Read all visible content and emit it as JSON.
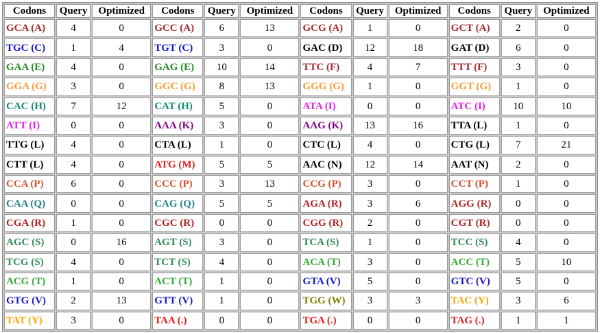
{
  "headers": [
    "Codons",
    "Query",
    "Optimized",
    "Codons",
    "Query",
    "Optimized",
    "Codons",
    "Query",
    "Optimized",
    "Codons",
    "Query",
    "Optimized"
  ],
  "rows": [
    [
      {
        "codon": "GCA (A)",
        "color": "#a52a2a",
        "query": "4",
        "optimized": "0"
      },
      {
        "codon": "GCC (A)",
        "color": "#a52a2a",
        "query": "6",
        "optimized": "13"
      },
      {
        "codon": "GCG (A)",
        "color": "#a52a2a",
        "query": "1",
        "optimized": "0"
      },
      {
        "codon": "GCT (A)",
        "color": "#a52a2a",
        "query": "2",
        "optimized": "0"
      }
    ],
    [
      {
        "codon": "TGC (C)",
        "color": "#1010d0",
        "query": "1",
        "optimized": "4"
      },
      {
        "codon": "TGT (C)",
        "color": "#1010d0",
        "query": "3",
        "optimized": "0"
      },
      {
        "codon": "GAC (D)",
        "color": "#000000",
        "query": "12",
        "optimized": "18"
      },
      {
        "codon": "GAT (D)",
        "color": "#000000",
        "query": "6",
        "optimized": "0"
      }
    ],
    [
      {
        "codon": "GAA (E)",
        "color": "#228b22",
        "query": "4",
        "optimized": "0"
      },
      {
        "codon": "GAG (E)",
        "color": "#228b22",
        "query": "10",
        "optimized": "14"
      },
      {
        "codon": "TTC (F)",
        "color": "#a52a2a",
        "query": "4",
        "optimized": "7"
      },
      {
        "codon": "TTT (F)",
        "color": "#a52a2a",
        "query": "3",
        "optimized": "0"
      }
    ],
    [
      {
        "codon": "GGA (G)",
        "color": "#ff9933",
        "query": "3",
        "optimized": "0"
      },
      {
        "codon": "GGC (G)",
        "color": "#ff9933",
        "query": "8",
        "optimized": "13"
      },
      {
        "codon": "GGG (G)",
        "color": "#ff9933",
        "query": "1",
        "optimized": "0"
      },
      {
        "codon": "GGT (G)",
        "color": "#ff9933",
        "query": "1",
        "optimized": "0"
      }
    ],
    [
      {
        "codon": "CAC (H)",
        "color": "#138a75",
        "query": "7",
        "optimized": "12"
      },
      {
        "codon": "CAT (H)",
        "color": "#138a75",
        "query": "5",
        "optimized": "0"
      },
      {
        "codon": "ATA (I)",
        "color": "#e620e6",
        "query": "0",
        "optimized": "0"
      },
      {
        "codon": "ATC (I)",
        "color": "#e620e6",
        "query": "10",
        "optimized": "10"
      }
    ],
    [
      {
        "codon": "ATT (I)",
        "color": "#e620e6",
        "query": "0",
        "optimized": "0"
      },
      {
        "codon": "AAA (K)",
        "color": "#800080",
        "query": "3",
        "optimized": "0"
      },
      {
        "codon": "AAG (K)",
        "color": "#800080",
        "query": "13",
        "optimized": "16"
      },
      {
        "codon": "TTA (L)",
        "color": "#000000",
        "query": "1",
        "optimized": "0"
      }
    ],
    [
      {
        "codon": "TTG (L)",
        "color": "#000000",
        "query": "4",
        "optimized": "0"
      },
      {
        "codon": "CTA (L)",
        "color": "#000000",
        "query": "1",
        "optimized": "0"
      },
      {
        "codon": "CTC (L)",
        "color": "#000000",
        "query": "4",
        "optimized": "0"
      },
      {
        "codon": "CTG (L)",
        "color": "#000000",
        "query": "7",
        "optimized": "21"
      }
    ],
    [
      {
        "codon": "CTT (L)",
        "color": "#000000",
        "query": "4",
        "optimized": "0"
      },
      {
        "codon": "ATG (M)",
        "color": "#e01b1b",
        "query": "5",
        "optimized": "5"
      },
      {
        "codon": "AAC (N)",
        "color": "#000000",
        "query": "12",
        "optimized": "14"
      },
      {
        "codon": "AAT (N)",
        "color": "#000000",
        "query": "2",
        "optimized": "0"
      }
    ],
    [
      {
        "codon": "CCA (P)",
        "color": "#d2522f",
        "query": "6",
        "optimized": "0"
      },
      {
        "codon": "CCC (P)",
        "color": "#d2522f",
        "query": "3",
        "optimized": "13"
      },
      {
        "codon": "CCG (P)",
        "color": "#d2522f",
        "query": "3",
        "optimized": "0"
      },
      {
        "codon": "CCT (P)",
        "color": "#d2522f",
        "query": "1",
        "optimized": "0"
      }
    ],
    [
      {
        "codon": "CAA (Q)",
        "color": "#1f7f8c",
        "query": "0",
        "optimized": "0"
      },
      {
        "codon": "CAG (Q)",
        "color": "#1f7f8c",
        "query": "5",
        "optimized": "5"
      },
      {
        "codon": "AGA (R)",
        "color": "#b22222",
        "query": "3",
        "optimized": "6"
      },
      {
        "codon": "AGG (R)",
        "color": "#b22222",
        "query": "0",
        "optimized": "0"
      }
    ],
    [
      {
        "codon": "CGA (R)",
        "color": "#b22222",
        "query": "1",
        "optimized": "0"
      },
      {
        "codon": "CGC (R)",
        "color": "#b22222",
        "query": "0",
        "optimized": "0"
      },
      {
        "codon": "CGG (R)",
        "color": "#b22222",
        "query": "2",
        "optimized": "0"
      },
      {
        "codon": "CGT (R)",
        "color": "#b22222",
        "query": "0",
        "optimized": "0"
      }
    ],
    [
      {
        "codon": "AGC (S)",
        "color": "#2e8b57",
        "query": "0",
        "optimized": "16"
      },
      {
        "codon": "AGT (S)",
        "color": "#2e8b57",
        "query": "3",
        "optimized": "0"
      },
      {
        "codon": "TCA (S)",
        "color": "#2e8b57",
        "query": "1",
        "optimized": "0"
      },
      {
        "codon": "TCC (S)",
        "color": "#2e8b57",
        "query": "4",
        "optimized": "0"
      }
    ],
    [
      {
        "codon": "TCG (S)",
        "color": "#2e8b57",
        "query": "4",
        "optimized": "0"
      },
      {
        "codon": "TCT (S)",
        "color": "#2e8b57",
        "query": "4",
        "optimized": "0"
      },
      {
        "codon": "ACA (T)",
        "color": "#33a833",
        "query": "3",
        "optimized": "0"
      },
      {
        "codon": "ACC (T)",
        "color": "#33a833",
        "query": "5",
        "optimized": "10"
      }
    ],
    [
      {
        "codon": "ACG (T)",
        "color": "#33a833",
        "query": "1",
        "optimized": "0"
      },
      {
        "codon": "ACT (T)",
        "color": "#33a833",
        "query": "1",
        "optimized": "0"
      },
      {
        "codon": "GTA (V)",
        "color": "#1515c8",
        "query": "5",
        "optimized": "0"
      },
      {
        "codon": "GTC (V)",
        "color": "#1515c8",
        "query": "5",
        "optimized": "0"
      }
    ],
    [
      {
        "codon": "GTG (V)",
        "color": "#1515c8",
        "query": "2",
        "optimized": "13"
      },
      {
        "codon": "GTT (V)",
        "color": "#1515c8",
        "query": "1",
        "optimized": "0"
      },
      {
        "codon": "TGG (W)",
        "color": "#808000",
        "query": "3",
        "optimized": "3"
      },
      {
        "codon": "TAC (Y)",
        "color": "#ffa500",
        "query": "3",
        "optimized": "6"
      }
    ],
    [
      {
        "codon": "TAT (Y)",
        "color": "#ffa500",
        "query": "3",
        "optimized": "0"
      },
      {
        "codon": "TAA (.)",
        "color": "#e01b1b",
        "query": "0",
        "optimized": "0"
      },
      {
        "codon": "TGA (.)",
        "color": "#e01b1b",
        "query": "0",
        "optimized": "0"
      },
      {
        "codon": "TAG (.)",
        "color": "#e01b1b",
        "query": "1",
        "optimized": "1"
      }
    ]
  ]
}
